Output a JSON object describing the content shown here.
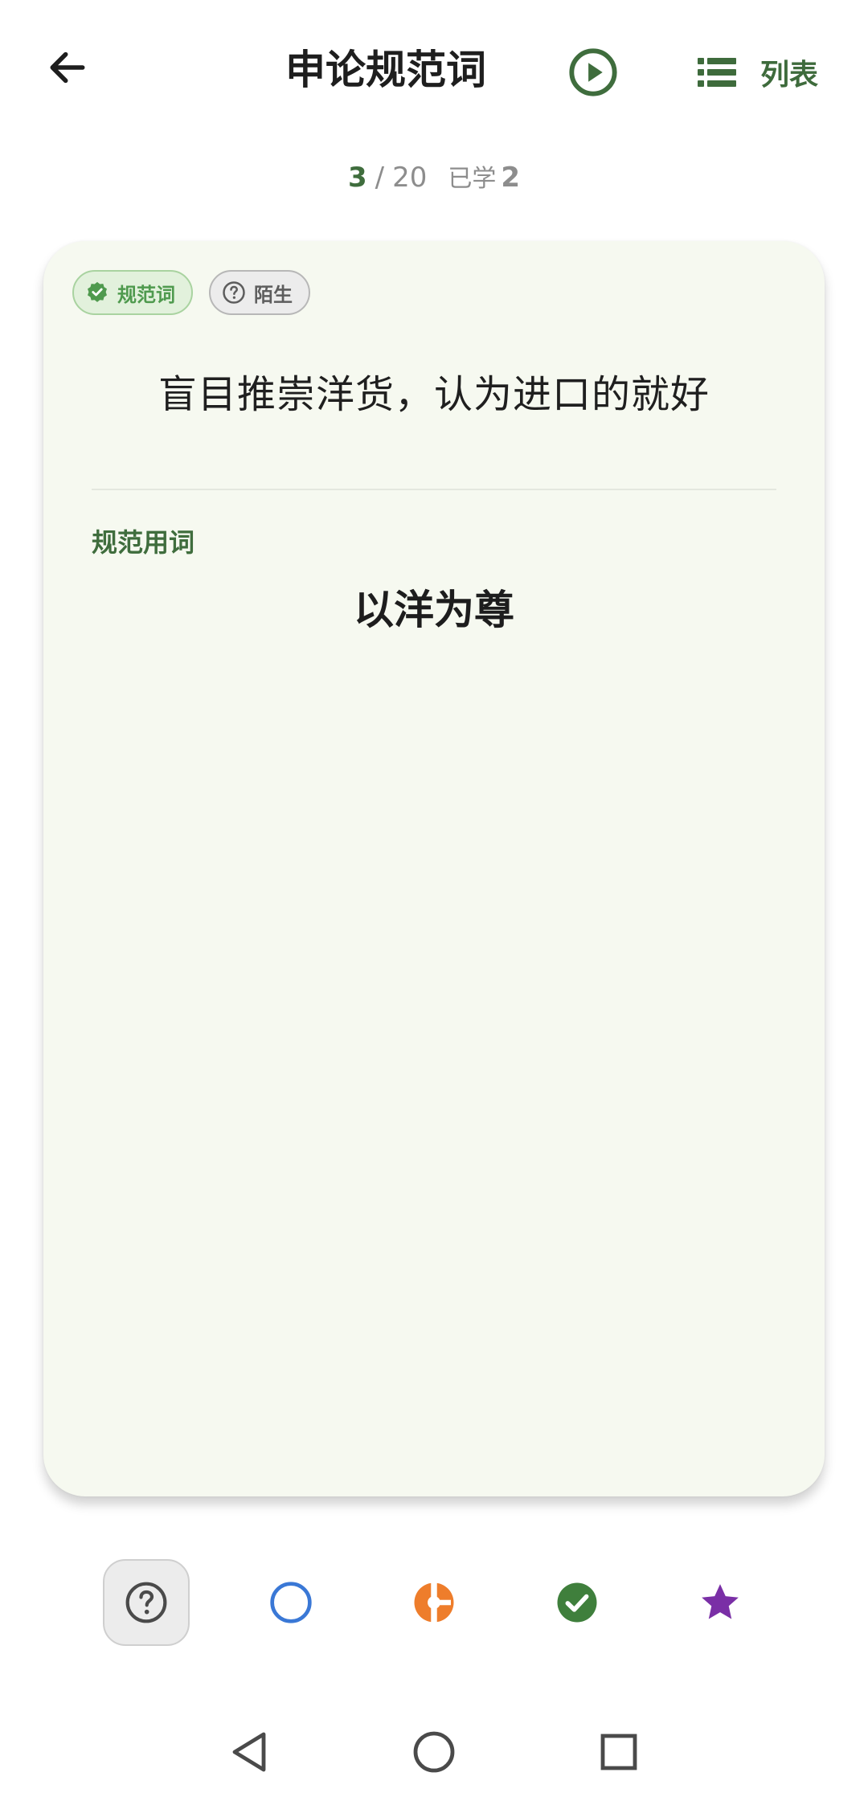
{
  "header": {
    "title": "申论规范词",
    "list_label": "列表"
  },
  "progress": {
    "current": "3",
    "separator": "/",
    "total": "20",
    "learned_label": "已学",
    "learned_count": "2"
  },
  "card": {
    "tags": {
      "standard": "规范词",
      "unknown": "陌生"
    },
    "word": "盲目推崇洋货，认为进口的就好",
    "section_label": "规范用词",
    "answer": "以洋为尊"
  },
  "status_buttons": [
    {
      "icon": "question-circle-icon",
      "active": true
    },
    {
      "icon": "circle-outline-icon",
      "color": "#3a78d6"
    },
    {
      "icon": "half-circle-icon",
      "color": "#ee7d2b"
    },
    {
      "icon": "check-circle-icon",
      "color": "#3f7f3c"
    },
    {
      "icon": "star-icon",
      "color": "#7a2fa6"
    }
  ],
  "colors": {
    "accent": "#3f6d3d",
    "card_bg": "#f6f9f0",
    "tag_green": "#4f9a4e"
  }
}
